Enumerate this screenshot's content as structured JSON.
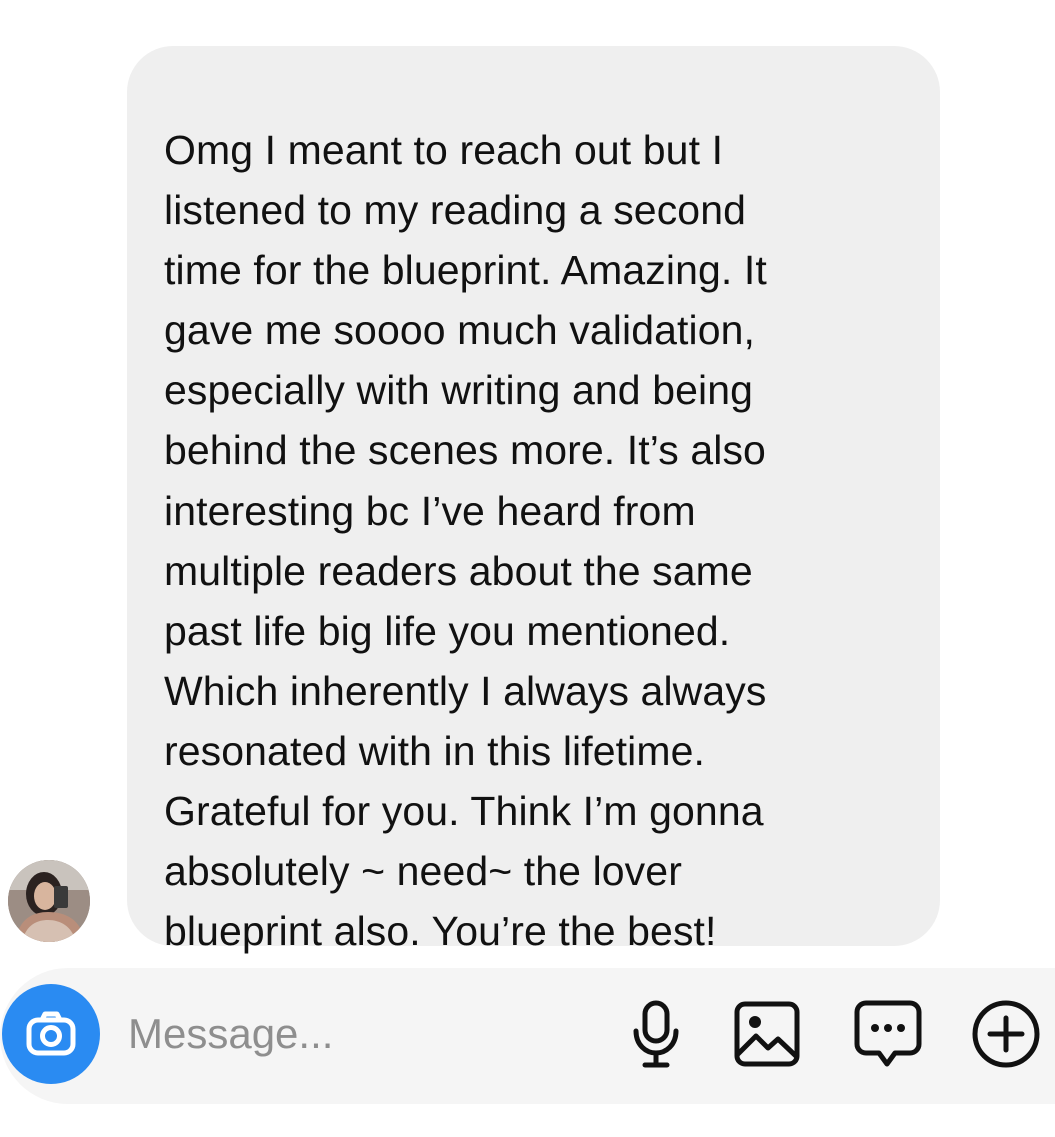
{
  "conversation": {
    "messages": [
      {
        "sender": "other",
        "avatar_icon": "user-avatar",
        "text": "Omg I meant to reach out but I\nlistened to my reading a second\ntime for the blueprint. Amazing. It\ngave me soooo much validation,\nespecially with writing and being\nbehind the scenes more. It’s also\ninteresting bc I’ve heard from\nmultiple readers about the same\npast life big life you mentioned.\nWhich inherently I always always\nresonated with in this lifetime.\nGrateful for you. Think I’m gonna\nabsolutely ~ need~ the lover\nblueprint also. You’re the best!"
      }
    ]
  },
  "composer": {
    "placeholder": "Message...",
    "value": "",
    "camera_icon": "camera-icon",
    "mic_icon": "microphone-icon",
    "gallery_icon": "image-icon",
    "sticker_icon": "chat-bubble-icon",
    "plus_icon": "plus-circle-icon"
  },
  "colors": {
    "bubble_bg": "#efefef",
    "composer_bg": "#f5f5f5",
    "accent": "#2a8bf2",
    "text": "#111111",
    "placeholder": "#8e8e8e"
  }
}
